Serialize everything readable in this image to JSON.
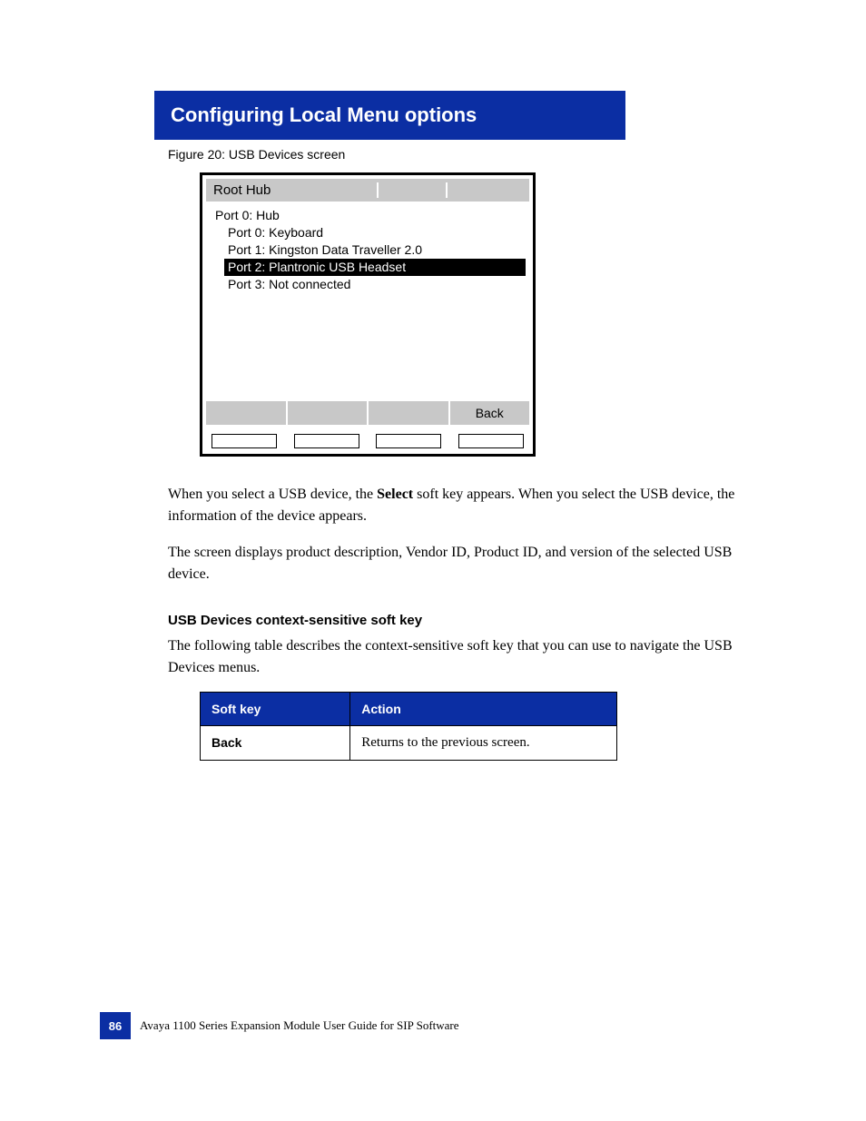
{
  "heading": "Configuring Local Menu options",
  "figure_caption": "Figure 20: USB Devices screen",
  "screen": {
    "title": "Root Hub",
    "devices": [
      {
        "text": "Port 0: Hub",
        "level": 0,
        "selected": false
      },
      {
        "text": "Port 0: Keyboard",
        "level": 1,
        "selected": false
      },
      {
        "text": "Port 1: Kingston Data Traveller 2.0",
        "level": 1,
        "selected": false
      },
      {
        "text": "Port 2: Plantronic USB Headset",
        "level": 1,
        "selected": true
      },
      {
        "text": "Port 3: Not connected",
        "level": 1,
        "selected": false
      }
    ],
    "softkeys": [
      "",
      "",
      "",
      "Back"
    ]
  },
  "paragraphs": {
    "p1_a": "When you select a USB device, the ",
    "p1_bold": "Select",
    "p1_b": " soft key appears. When you select the USB device, the information of the device appears.",
    "p2": "The screen displays product description, Vendor ID, Product ID, and version of the selected USB device.",
    "p3": "The following table describes the context-sensitive soft key that you can use to navigate the USB Devices menus."
  },
  "table_section_heading": "USB Devices context-sensitive soft key",
  "table": {
    "headers": [
      "Soft key",
      "Action"
    ],
    "rows": [
      [
        "Back",
        "Returns to the previous screen."
      ]
    ]
  },
  "footer": {
    "page_number": "86",
    "text": "Avaya 1100 Series Expansion Module User Guide for SIP Software"
  }
}
